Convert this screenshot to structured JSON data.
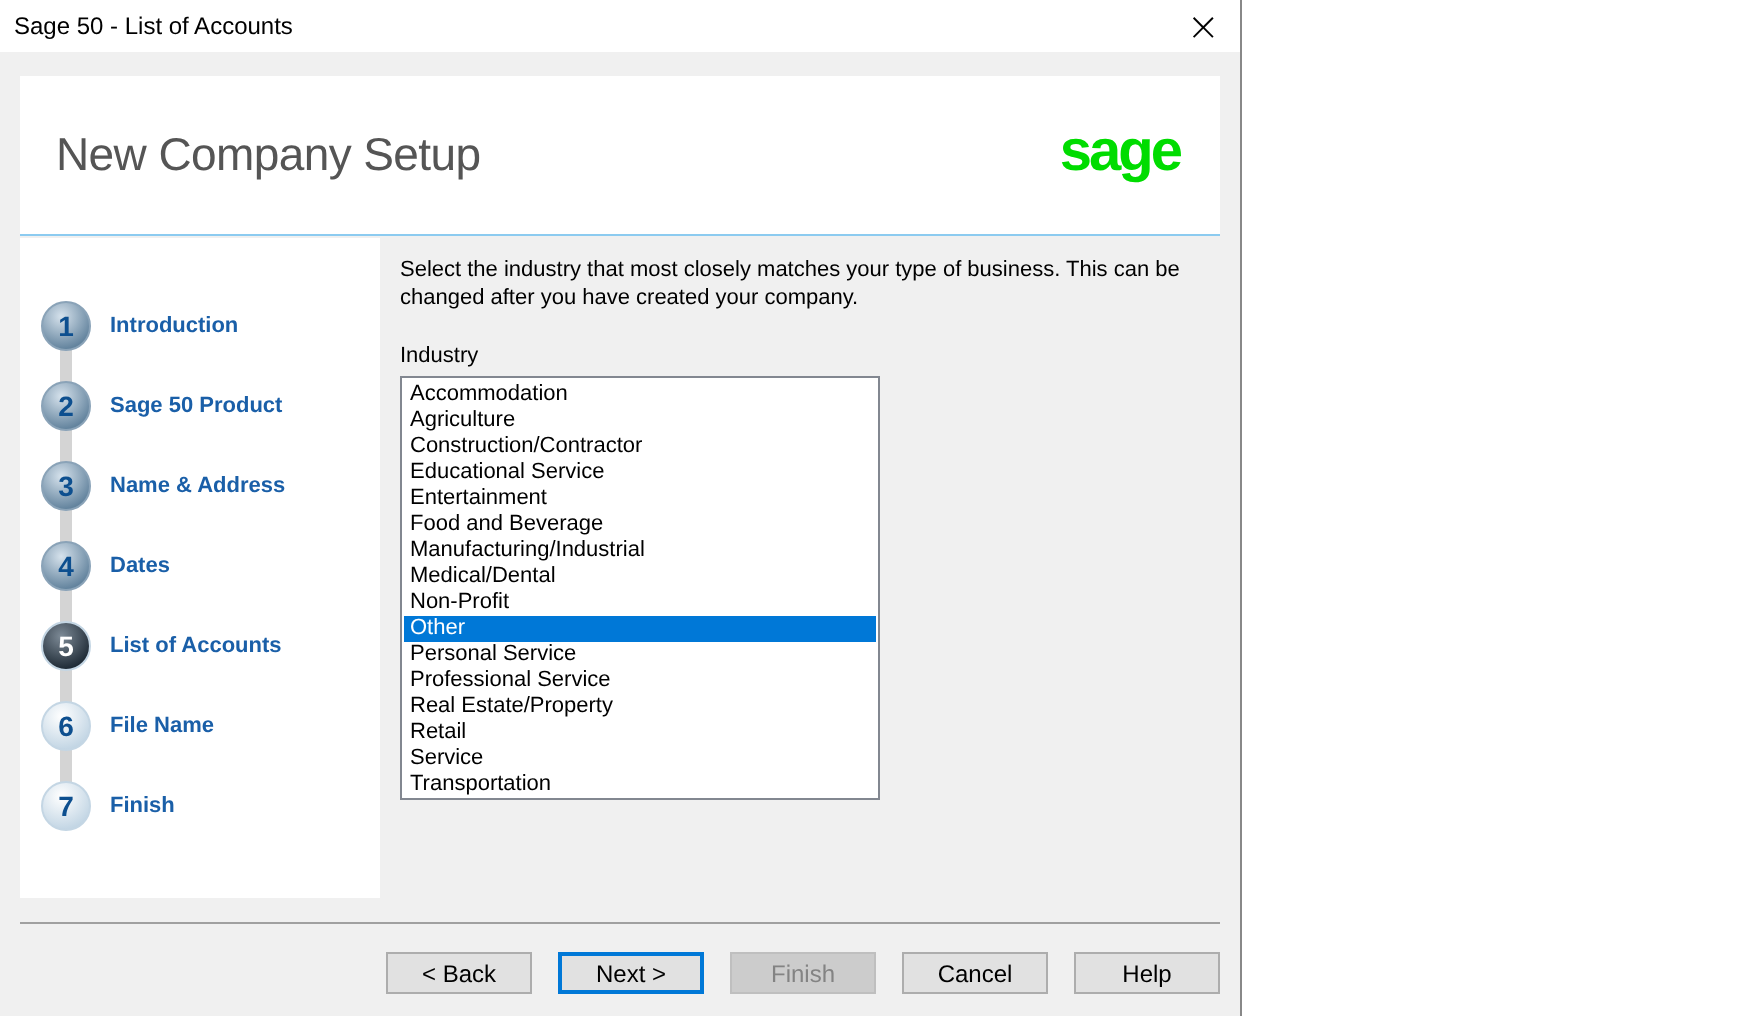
{
  "window": {
    "title": "Sage 50 - List of Accounts",
    "close": "×"
  },
  "header": {
    "title": "New Company Setup",
    "logo": "sage"
  },
  "steps": [
    {
      "number": "1",
      "label": "Introduction",
      "completed": true,
      "selected": false
    },
    {
      "number": "2",
      "label": "Sage 50 Product",
      "completed": true,
      "selected": false
    },
    {
      "number": "3",
      "label": "Name & Address",
      "completed": true,
      "selected": false
    },
    {
      "number": "4",
      "label": "Dates",
      "completed": true,
      "selected": false
    },
    {
      "number": "5",
      "label": "List of Accounts",
      "completed": false,
      "selected": true
    },
    {
      "number": "6",
      "label": "File Name",
      "completed": false,
      "selected": false
    },
    {
      "number": "7",
      "label": "Finish",
      "completed": false,
      "selected": false
    }
  ],
  "instructions": "Select the industry that most closely matches your type of business. This can be changed after you have created your company.",
  "industry": {
    "label": "Industry",
    "items": [
      {
        "text": "Accommodation",
        "selected": false
      },
      {
        "text": "Agriculture",
        "selected": false
      },
      {
        "text": "Construction/Contractor",
        "selected": false
      },
      {
        "text": "Educational Service",
        "selected": false
      },
      {
        "text": "Entertainment",
        "selected": false
      },
      {
        "text": "Food and Beverage",
        "selected": false
      },
      {
        "text": "Manufacturing/Industrial",
        "selected": false
      },
      {
        "text": "Medical/Dental",
        "selected": false
      },
      {
        "text": "Non-Profit",
        "selected": false
      },
      {
        "text": "Other",
        "selected": true
      },
      {
        "text": "Personal Service",
        "selected": false
      },
      {
        "text": "Professional Service",
        "selected": false
      },
      {
        "text": "Real Estate/Property",
        "selected": false
      },
      {
        "text": "Retail",
        "selected": false
      },
      {
        "text": "Service",
        "selected": false
      },
      {
        "text": "Transportation",
        "selected": false
      }
    ]
  },
  "buttons": [
    {
      "label": "< Back",
      "disabled": false,
      "focused": false
    },
    {
      "label": "Next >",
      "disabled": false,
      "focused": true
    },
    {
      "label": "Finish",
      "disabled": true,
      "focused": false
    },
    {
      "label": "Cancel",
      "disabled": false,
      "focused": false
    },
    {
      "label": "Help",
      "disabled": false,
      "focused": false
    }
  ]
}
